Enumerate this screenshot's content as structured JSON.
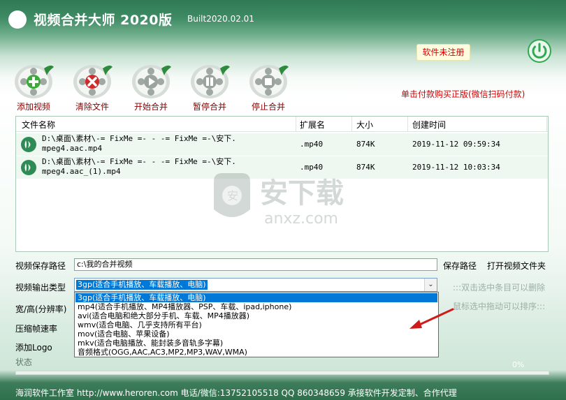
{
  "titlebar": {
    "title": "视频合并大师 2020版",
    "build": "Built2020.02.01"
  },
  "registration": {
    "label": "软件未注册"
  },
  "toolbar": [
    {
      "label": "添加视频",
      "icon": "add-icon"
    },
    {
      "label": "清除文件",
      "icon": "clear-icon"
    },
    {
      "label": "开始合并",
      "icon": "play-icon"
    },
    {
      "label": "暂停合并",
      "icon": "pause-icon"
    },
    {
      "label": "停止合并",
      "icon": "stop-icon"
    }
  ],
  "buy_link": "单击付款购买正版(微信扫码付款)",
  "table": {
    "columns": [
      "文件名称",
      "扩展名",
      "大小",
      "创建时间"
    ],
    "rows": [
      {
        "name": "D:\\桌面\\素材\\-= FixMe =- - -= FixMe =-\\安下.\nmpeg4.aac.mp4",
        "ext": ".mp40",
        "size": "874K",
        "created": "2019-11-12 09:59:34"
      },
      {
        "name": "D:\\桌面\\素材\\-= FixMe =- - -= FixMe =-\\安下.\nmpeg4.aac_(1).mp4",
        "ext": ".mp40",
        "size": "874K",
        "created": "2019-11-12 10:03:34"
      }
    ]
  },
  "watermark": {
    "text": "安下载",
    "domain": "anxz.com"
  },
  "form": {
    "save_path_label": "视频保存路径",
    "save_path_value": "c:\\我的合并视频",
    "save_path_button": "保存路径",
    "open_folder_button": "打开视频文件夹",
    "output_type_label": "视频输出类型",
    "output_type_value": "3gp(适合手机播放、车载播放、电脑)",
    "output_type_options": [
      "3gp(适合手机播放、车载播放、电脑)",
      "mp4(适合手机播放、MP4播放器、PSP、车载、ipad,iphone)",
      "avi(适合电脑和绝大部分手机、车载、MP4播放器)",
      "wmv(适合电脑、几乎支持所有平台)",
      "mov(适合电脑、苹果设备)",
      "mkv(适合电脑播放、能封装多音轨多字幕)",
      "音频格式(OGG,AAC,AC3,MP2,MP3,WAV,WMA)"
    ],
    "resolution_label": "宽/高(分辨率)",
    "framerate_label": "压缩帧速率",
    "logo_label": "添加Logo",
    "hint_remove": ":::双击选中条目可以删除",
    "hint_sort": "鼠标选中拖动可以排序:::"
  },
  "status": {
    "label": "状态",
    "percent": "0%",
    "progress": 0
  },
  "footer": "海润软件工作室 http://www.heroren.com 电话/微信:13752105518 QQ 860348659 承接软件开发定制、合作代理"
}
